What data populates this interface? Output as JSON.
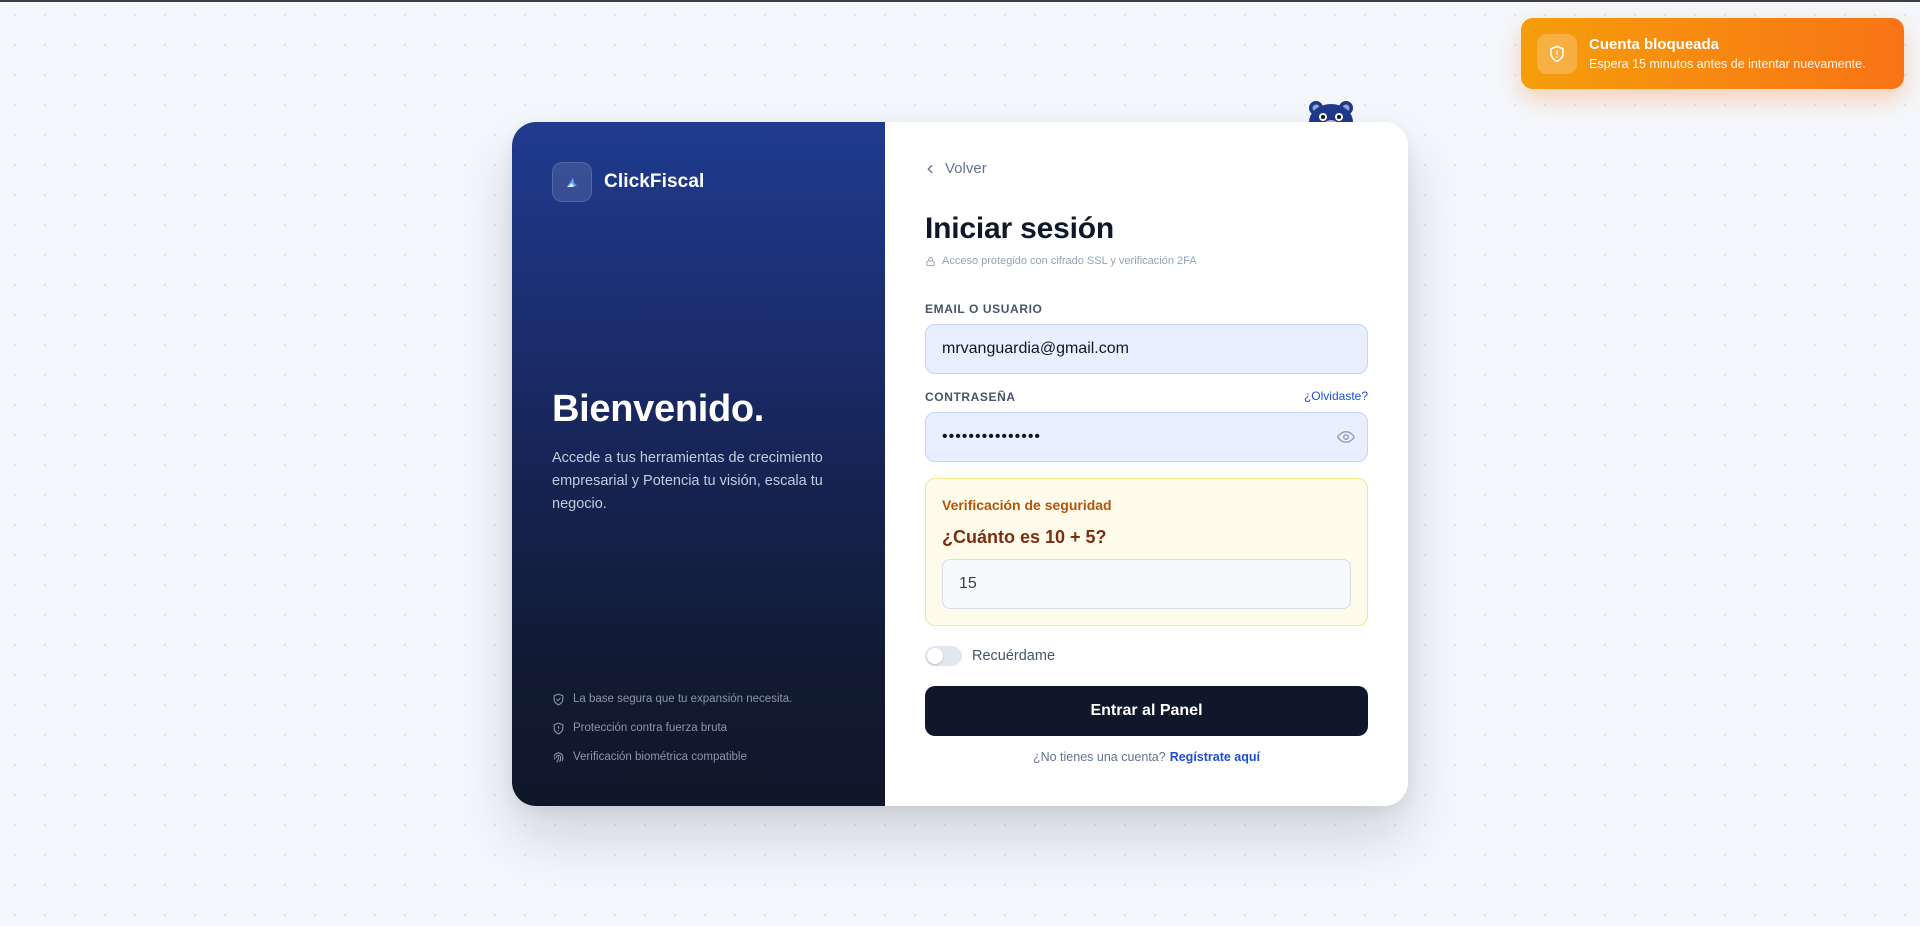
{
  "toast": {
    "title": "Cuenta bloqueada",
    "message": "Espera 15 minutos antes de intentar nuevamente.",
    "icon": "shield-alert-icon",
    "colors": {
      "from": "#f59e0b",
      "to": "#f97316"
    }
  },
  "brand": {
    "name": "ClickFiscal",
    "icon": "logo-icon"
  },
  "hero": {
    "title": "Bienvenido.",
    "description": "Accede a tus herramientas de crecimiento empresarial y Potencia tu visión, escala tu negocio."
  },
  "features": [
    {
      "icon": "shield-check-icon",
      "label": "La base segura que tu expansión necesita."
    },
    {
      "icon": "shield-icon",
      "label": "Protección contra fuerza bruta"
    },
    {
      "icon": "fingerprint-icon",
      "label": "Verificación biométrica compatible"
    }
  ],
  "form": {
    "back_label": "Volver",
    "title": "Iniciar sesión",
    "subtitle": "Acceso protegido con cifrado SSL y verificación 2FA",
    "email_label": "EMAIL O USUARIO",
    "email_value": "mrvanguardia@gmail.com",
    "password_label": "CONTRASEÑA",
    "forgot_label": "¿Olvidaste?",
    "password_value": "•••••••••••••••",
    "captcha": {
      "label": "Verificación de seguridad",
      "question": "¿Cuánto es 10 + 5?",
      "answer": "15"
    },
    "remember_label": "Recuérdame",
    "remember_checked": false,
    "submit_label": "Entrar al Panel",
    "register_prompt": "¿No tienes una cuenta?",
    "register_link": "Regístrate aquí"
  },
  "colors": {
    "primary": "#0f172a",
    "accent": "#1d4ed8",
    "panel_top": "#1f3b8f"
  }
}
